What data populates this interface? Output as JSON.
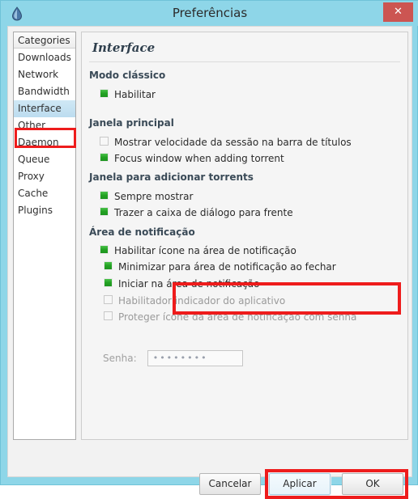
{
  "window": {
    "title": "Preferências",
    "app_icon": "deluge-droplet-icon",
    "close_label": "✕",
    "frame_color": "#8ed6e8",
    "close_button_color": "#cc5552",
    "highlight_color": "#ee1c1c"
  },
  "sidebar": {
    "header": "Categories",
    "items": [
      {
        "label": "Downloads",
        "selected": false
      },
      {
        "label": "Network",
        "selected": false
      },
      {
        "label": "Bandwidth",
        "selected": false
      },
      {
        "label": "Interface",
        "selected": true
      },
      {
        "label": "Other",
        "selected": false
      },
      {
        "label": "Daemon",
        "selected": false
      },
      {
        "label": "Queue",
        "selected": false
      },
      {
        "label": "Proxy",
        "selected": false
      },
      {
        "label": "Cache",
        "selected": false
      },
      {
        "label": "Plugins",
        "selected": false
      }
    ]
  },
  "content": {
    "title": "Interface",
    "sections": [
      {
        "header": "Modo clássico",
        "options": [
          {
            "label": "Habilitar",
            "checked": true,
            "disabled": false
          }
        ]
      },
      {
        "header": "Janela principal",
        "options": [
          {
            "label": "Mostrar velocidade da sessão na barra de títulos",
            "checked": false,
            "disabled": false
          },
          {
            "label": "Focus window when adding torrent",
            "checked": true,
            "disabled": false
          }
        ]
      },
      {
        "header": "Janela para adicionar torrents",
        "options": [
          {
            "label": "Sempre mostrar",
            "checked": true,
            "disabled": false
          },
          {
            "label": "Trazer a caixa de diálogo para frente",
            "checked": true,
            "disabled": false
          }
        ]
      },
      {
        "header": "Área de notificação",
        "options": [
          {
            "label": "Habilitar ícone na área de notificação",
            "checked": true,
            "disabled": false
          },
          {
            "label": "Minimizar para área de notificação ao fechar",
            "checked": true,
            "disabled": false
          },
          {
            "label": "Iniciar na área de notificação",
            "checked": true,
            "disabled": false
          },
          {
            "label": "Habilitador indicador do aplicativo",
            "checked": false,
            "disabled": true
          },
          {
            "label": "Proteger ícone da área de notificação com senha",
            "checked": false,
            "disabled": true
          }
        ]
      }
    ],
    "password_field": {
      "label": "Senha:",
      "value": "••••••••"
    }
  },
  "buttons": {
    "cancel": "Cancelar",
    "apply": "Aplicar",
    "ok": "OK"
  }
}
